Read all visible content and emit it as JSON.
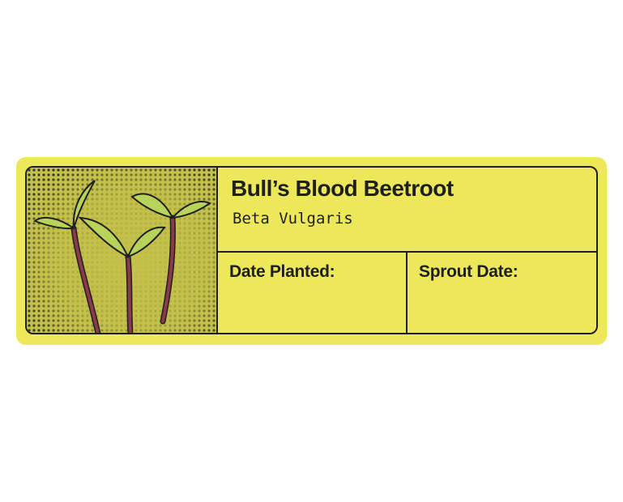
{
  "label": {
    "common_name": "Bull’s Blood Beetroot",
    "latin_name": "Beta Vulgaris",
    "fields": {
      "date_planted_label": "Date Planted:",
      "sprout_date_label": "Sprout Date:"
    },
    "illustration": {
      "subject": "beetroot-sprouts-illustration",
      "background_color": "#c4c14a",
      "dot_color": "#1f1f1f",
      "leaf_color": "#b7d35a",
      "stem_color": "#8a3a4a"
    },
    "colors": {
      "label_background": "#ede85a",
      "ink": "#1f1f1f"
    }
  }
}
